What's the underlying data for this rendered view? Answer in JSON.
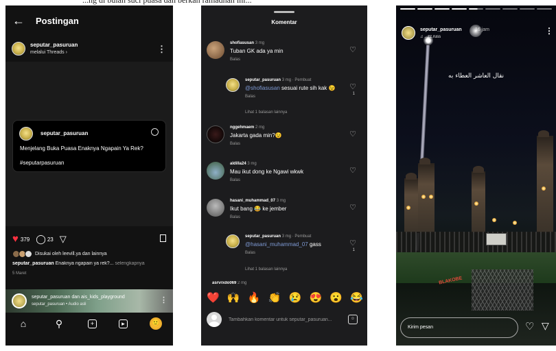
{
  "top_caption": "...ng di bulan suci puasa dan berkah ramadhan ini...",
  "post_screen": {
    "title": "Postingan",
    "author": "seputar_pasuruan",
    "author_sub": "melalui Threads ›",
    "card": {
      "username": "seputar_pasuruan",
      "text": "Menjelang Buka Puasa Enaknya Ngapain Ya Rek?",
      "hashtag": "#seputarpasuruan"
    },
    "likes": "379",
    "comments": "23",
    "liked_by": "Disukai oleh leevill.ya dan lainnya",
    "caption_user": "seputar_pasuruan",
    "caption_text": "Enaknya ngapain ya rek?...",
    "caption_more": "selengkapnya",
    "date": "5 Maret",
    "audio_title": "seputar_pasuruan dan ais_kids_playground",
    "audio_sub": "seputar_pasuruan • Audio asli",
    "icons": {
      "back": "back-arrow-icon",
      "heart": "heart-icon",
      "comment": "comment-icon",
      "share": "send-icon",
      "bookmark": "bookmark-icon",
      "home": "home-icon",
      "search": "search-icon",
      "add": "add-icon",
      "reels": "reels-icon"
    }
  },
  "comments_screen": {
    "title": "Komentar",
    "reply_label": "Balas",
    "comments": [
      {
        "user": "shofiasusan",
        "time": "3 mg",
        "text": "Tuban GK ada ya min",
        "reply": false,
        "count": ""
      },
      {
        "user": "seputar_pasuruan",
        "time": "3 mg · Pembuat",
        "mention": "@shofiasusan",
        "text": " sesuai rute sih kak 😉",
        "reply": true,
        "count": "1",
        "more": "Lihat 1 balasan lainnya"
      },
      {
        "user": "nggehmaem",
        "time": "2 mg",
        "text": "Jakarta gada min?😉",
        "reply": false,
        "count": ""
      },
      {
        "user": "aldilla24",
        "time": "3 mg",
        "text": "Mau ikut dong ke Ngawi wkwk",
        "reply": false,
        "count": ""
      },
      {
        "user": "hasani_muhammad_07",
        "time": "3 mg",
        "text": "Ikut bang 😂 ke jember",
        "reply": false,
        "count": ""
      },
      {
        "user": "seputar_pasuruan",
        "time": "3 mg · Pembuat",
        "mention": "@hasani_muhammad_07",
        "text": " gass",
        "reply": true,
        "count": "1",
        "more": "Lihat 1 balasan lainnya"
      },
      {
        "user": "asrvrxdo069",
        "time": "2 mg",
        "text": "",
        "reply": false,
        "count": ""
      }
    ],
    "emojis": [
      "❤️",
      "🙌",
      "🔥",
      "👏",
      "😢",
      "😍",
      "😮",
      "😂"
    ],
    "input_placeholder": "Tambahkan komentar untuk seputar_pasuruan..."
  },
  "story_screen": {
    "username": "seputar_pasuruan",
    "time": "16 jam",
    "music": "♫ ...zz.russ",
    "arabic_text": "نقال العاشر العطاء به",
    "message_placeholder": "Kirim pesan",
    "ground_text": "BLAKOBE",
    "progress": [
      1,
      1,
      1,
      1,
      0.6,
      0,
      0,
      0,
      0
    ]
  }
}
